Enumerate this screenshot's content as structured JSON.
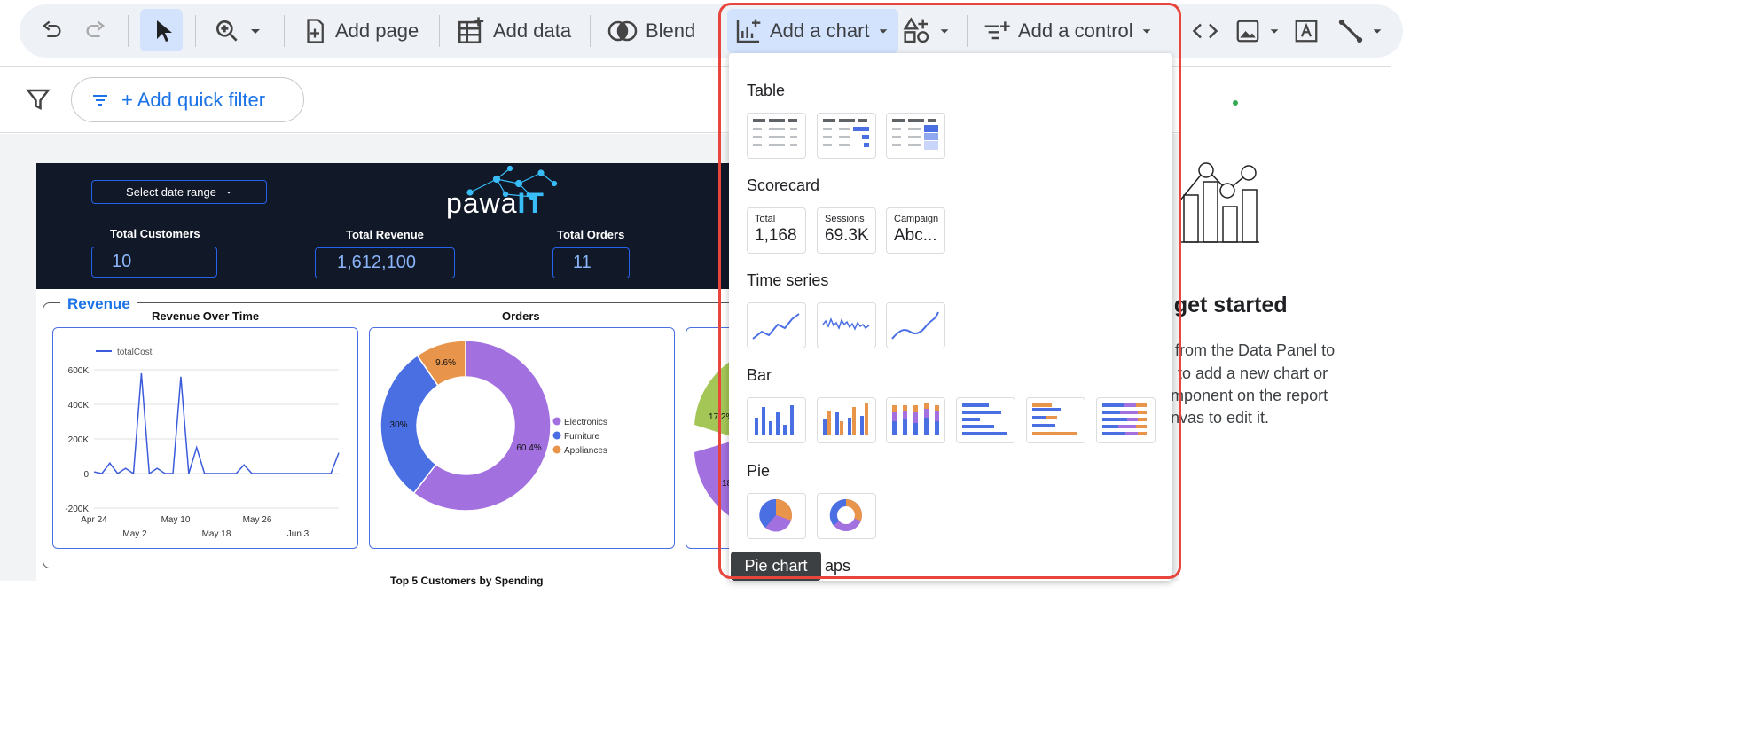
{
  "toolbar": {
    "add_page": "Add page",
    "add_data": "Add data",
    "blend": "Blend",
    "add_chart": "Add a chart",
    "add_control": "Add a control"
  },
  "filterbar": {
    "quick_filter": "+ Add quick filter"
  },
  "report": {
    "date_range": "Select date range",
    "logo_main": "pawa",
    "logo_accent": "IT",
    "kpis": [
      {
        "label": "Total Customers",
        "value": "10"
      },
      {
        "label": "Total Revenue",
        "value": "1,612,100"
      },
      {
        "label": "Total Orders",
        "value": "11"
      }
    ],
    "section_title": "Revenue",
    "line_chart_title": "Revenue Over Time",
    "donut_title": "Orders",
    "bottom_title": "Top 5 Customers by Spending",
    "partial_labels": [
      "17.2%",
      "18"
    ]
  },
  "chart_data": [
    {
      "type": "line",
      "title": "Revenue Over Time",
      "series": [
        {
          "name": "totalCost",
          "values": [
            10000,
            0,
            60000,
            0,
            30000,
            0,
            580000,
            0,
            30000,
            0,
            0,
            560000,
            0,
            150000,
            0,
            0,
            0,
            0,
            0,
            50000,
            0,
            0,
            0,
            0,
            0,
            0,
            0,
            0,
            0,
            0,
            0,
            120000
          ]
        }
      ],
      "x_ticks_top": [
        "Apr 24",
        "May 10",
        "May 26"
      ],
      "x_ticks_bottom": [
        "May 2",
        "May 18",
        "Jun 3"
      ],
      "y_ticks": [
        "600K",
        "400K",
        "200K",
        "0",
        "-200K"
      ],
      "ylim": [
        -200000,
        600000
      ]
    },
    {
      "type": "pie",
      "title": "Orders",
      "categories": [
        "Electronics",
        "Furniture",
        "Appliances"
      ],
      "values": [
        60.4,
        30,
        9.6
      ],
      "labels": [
        "60.4%",
        "30%",
        "9.6%"
      ],
      "colors": [
        "#a370e0",
        "#4a6fe3",
        "#e8944a"
      ]
    }
  ],
  "dropdown": {
    "categories": [
      "Table",
      "Scorecard",
      "Time series",
      "Bar",
      "Pie"
    ],
    "scorecards": [
      {
        "label": "Total",
        "value": "1,168"
      },
      {
        "label": "Sessions",
        "value": "69.3K"
      },
      {
        "label": "Campaign",
        "value": "Abc..."
      }
    ],
    "tooltip": "Pie chart",
    "maps_fragment": "aps"
  },
  "right_panel": {
    "title": "s get started",
    "lines": [
      "from the Data Panel to",
      "to add a new chart or",
      "mponent on the report",
      "nvas to edit it."
    ]
  }
}
